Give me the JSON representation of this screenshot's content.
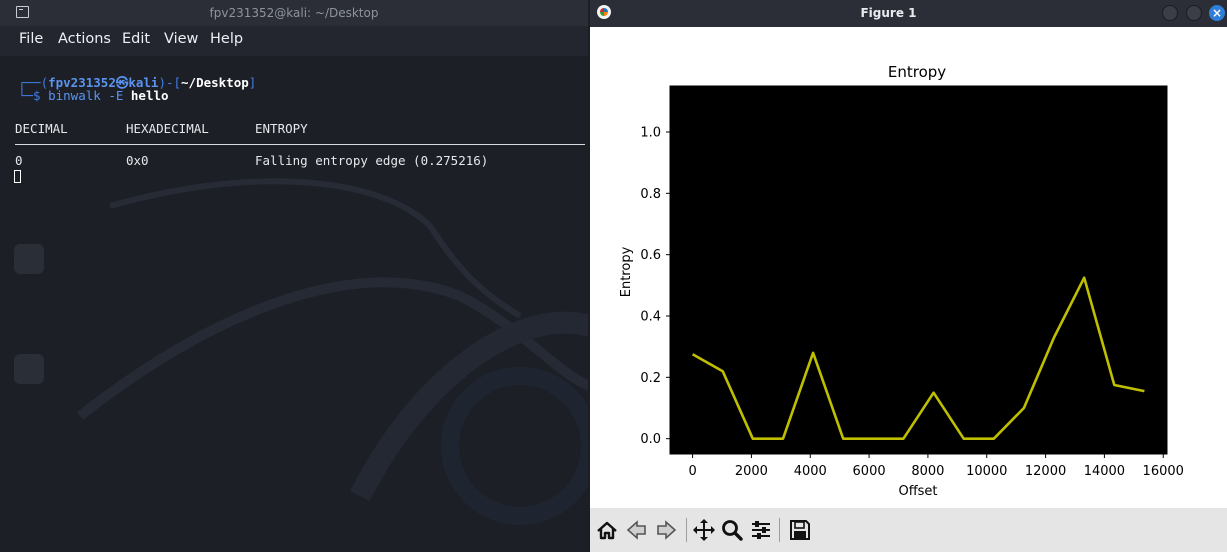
{
  "terminal": {
    "title": "fpv231352@kali: ~/Desktop",
    "menu": [
      "File",
      "Actions",
      "Edit",
      "View",
      "Help"
    ],
    "prompt": {
      "open": "┌──(",
      "user": "fpv231352㉿kali",
      "mid": ")-[",
      "path": "~/Desktop",
      "close": "]",
      "line2_prefix": "└─$ ",
      "command": "binwalk -E",
      "argument": " hello"
    },
    "table": {
      "headers": [
        "DECIMAL",
        "HEXADECIMAL",
        "ENTROPY"
      ],
      "rows": [
        [
          "0",
          "0x0",
          "Falling entropy edge (0.275216)"
        ]
      ]
    }
  },
  "figure": {
    "title": "Figure 1",
    "toolbar": [
      "home-icon",
      "back-icon",
      "forward-icon",
      "pan-icon",
      "zoom-icon",
      "subplots-icon",
      "save-icon"
    ]
  },
  "chart_data": {
    "type": "line",
    "title": "Entropy",
    "xlabel": "Offset",
    "ylabel": "Entropy",
    "x": [
      0,
      1024,
      2048,
      3072,
      4096,
      5120,
      6144,
      7168,
      8192,
      9216,
      10240,
      11264,
      12288,
      13312,
      14336,
      15360
    ],
    "series": [
      {
        "values": [
          0.275,
          0.22,
          0.0,
          0.0,
          0.28,
          0.0,
          0.0,
          0.0,
          0.15,
          0.0,
          0.0,
          0.1,
          0.33,
          0.525,
          0.175,
          0.155
        ]
      }
    ],
    "xlim": [
      -768,
      16128
    ],
    "ylim": [
      -0.05,
      1.15
    ],
    "xticks": [
      0,
      2000,
      4000,
      6000,
      8000,
      10000,
      12000,
      14000,
      16000
    ],
    "yticks": [
      0.0,
      0.2,
      0.4,
      0.6,
      0.8,
      1.0
    ],
    "plot_background": "#000000",
    "line_color": "#bfbf00",
    "grid": false,
    "legend": false
  }
}
